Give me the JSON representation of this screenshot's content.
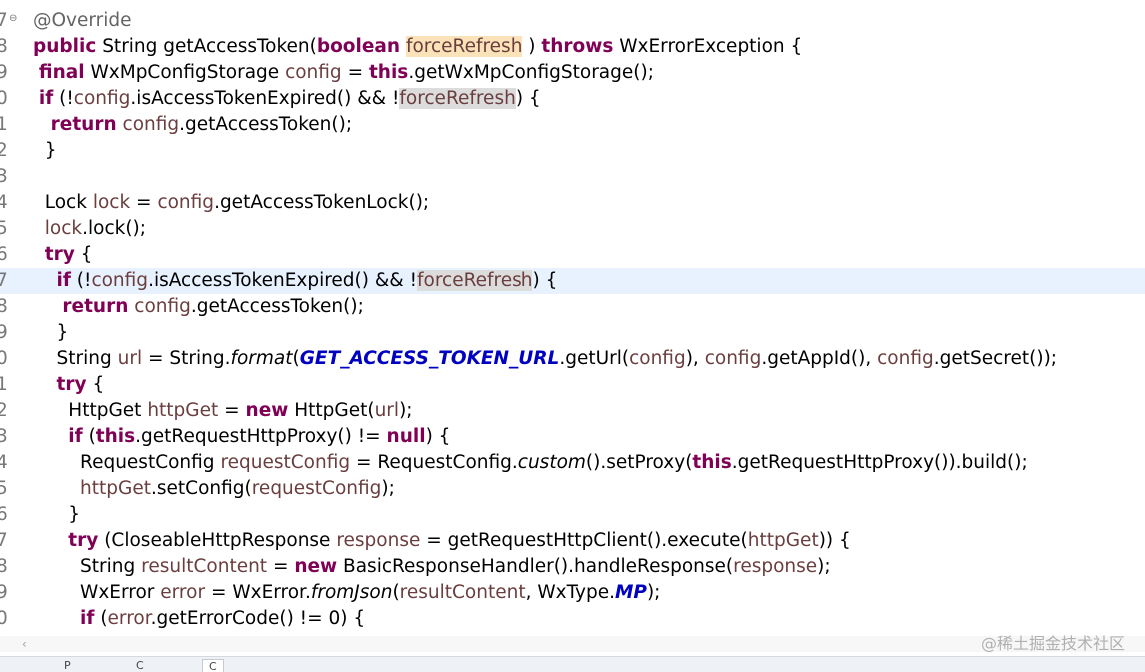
{
  "editor": {
    "current_line_number": "7",
    "lines": [
      {
        "n": "7",
        "fold": "⊖",
        "tokens": [
          [
            "ann",
            "@Override"
          ]
        ]
      },
      {
        "n": "8",
        "tokens": [
          [
            "kw",
            "public"
          ],
          [
            "",
            " String getAccessToken("
          ],
          [
            "kw",
            "boolean"
          ],
          [
            "",
            " "
          ],
          [
            "var hlw",
            "forceRefresh"
          ],
          [
            "",
            " ) "
          ],
          [
            "kw",
            "throws"
          ],
          [
            "",
            " WxErrorException {"
          ]
        ]
      },
      {
        "n": "9",
        "tokens": [
          [
            "",
            " "
          ],
          [
            "kw",
            "final"
          ],
          [
            "",
            " WxMpConfigStorage "
          ],
          [
            "var",
            "config"
          ],
          [
            "",
            " = "
          ],
          [
            "kw",
            "this"
          ],
          [
            "",
            ".getWxMpConfigStorage();"
          ]
        ]
      },
      {
        "n": "0",
        "tokens": [
          [
            "",
            " "
          ],
          [
            "kw",
            "if"
          ],
          [
            "",
            " (!"
          ],
          [
            "var",
            "config"
          ],
          [
            "",
            ".isAccessTokenExpired() && !"
          ],
          [
            "var hlr",
            "forceRefresh"
          ],
          [
            "",
            ") {"
          ]
        ]
      },
      {
        "n": "1",
        "tokens": [
          [
            "",
            "   "
          ],
          [
            "kw",
            "return"
          ],
          [
            "",
            " "
          ],
          [
            "var",
            "config"
          ],
          [
            "",
            ".getAccessToken();"
          ]
        ]
      },
      {
        "n": "2",
        "tokens": [
          [
            "",
            "  }"
          ]
        ]
      },
      {
        "n": "3",
        "tokens": []
      },
      {
        "n": "4",
        "tokens": [
          [
            "",
            "  Lock "
          ],
          [
            "var",
            "lock"
          ],
          [
            "",
            " = "
          ],
          [
            "var",
            "config"
          ],
          [
            "",
            ".getAccessTokenLock();"
          ]
        ]
      },
      {
        "n": "5",
        "tokens": [
          [
            "",
            "  "
          ],
          [
            "var",
            "lock"
          ],
          [
            "",
            ".lock();"
          ]
        ]
      },
      {
        "n": "6",
        "tokens": [
          [
            "",
            "  "
          ],
          [
            "kw",
            "try"
          ],
          [
            "",
            " {"
          ]
        ]
      },
      {
        "n": "7",
        "current": true,
        "tokens": [
          [
            "",
            "    "
          ],
          [
            "kw",
            "if"
          ],
          [
            "",
            " (!"
          ],
          [
            "var",
            "config"
          ],
          [
            "",
            ".isAccessTokenExpired() && !"
          ],
          [
            "var hlr",
            "forceRefres"
          ],
          [
            "caret",
            ""
          ],
          [
            "var hlr",
            "h"
          ],
          [
            "",
            ") {"
          ]
        ]
      },
      {
        "n": "8",
        "tokens": [
          [
            "",
            "     "
          ],
          [
            "kw",
            "return"
          ],
          [
            "",
            " "
          ],
          [
            "var",
            "config"
          ],
          [
            "",
            ".getAccessToken();"
          ]
        ]
      },
      {
        "n": "9",
        "tokens": [
          [
            "",
            "    }"
          ]
        ]
      },
      {
        "n": "0",
        "tokens": [
          [
            "",
            "    String "
          ],
          [
            "var",
            "url"
          ],
          [
            "",
            " = String."
          ],
          [
            "it",
            "format"
          ],
          [
            "",
            "("
          ],
          [
            "fld",
            "GET_ACCESS_TOKEN_URL"
          ],
          [
            "",
            ".getUrl("
          ],
          [
            "var",
            "config"
          ],
          [
            "",
            "), "
          ],
          [
            "var",
            "config"
          ],
          [
            "",
            ".getAppId(), "
          ],
          [
            "var",
            "config"
          ],
          [
            "",
            ".getSecret());"
          ]
        ]
      },
      {
        "n": "1",
        "tokens": [
          [
            "",
            "    "
          ],
          [
            "kw",
            "try"
          ],
          [
            "",
            " {"
          ]
        ]
      },
      {
        "n": "2",
        "tokens": [
          [
            "",
            "      HttpGet "
          ],
          [
            "var",
            "httpGet"
          ],
          [
            "",
            " = "
          ],
          [
            "kw",
            "new"
          ],
          [
            "",
            " HttpGet("
          ],
          [
            "var",
            "url"
          ],
          [
            "",
            ");"
          ]
        ]
      },
      {
        "n": "3",
        "tokens": [
          [
            "",
            "      "
          ],
          [
            "kw",
            "if"
          ],
          [
            "",
            " ("
          ],
          [
            "kw",
            "this"
          ],
          [
            "",
            ".getRequestHttpProxy() != "
          ],
          [
            "kw",
            "null"
          ],
          [
            "",
            ") {"
          ]
        ]
      },
      {
        "n": "4",
        "tokens": [
          [
            "",
            "        RequestConfig "
          ],
          [
            "var",
            "requestConfig"
          ],
          [
            "",
            " = RequestConfig."
          ],
          [
            "it",
            "custom"
          ],
          [
            "",
            "().setProxy("
          ],
          [
            "kw",
            "this"
          ],
          [
            "",
            ".getRequestHttpProxy()).build();"
          ]
        ]
      },
      {
        "n": "5",
        "tokens": [
          [
            "",
            "        "
          ],
          [
            "var",
            "httpGet"
          ],
          [
            "",
            ".setConfig("
          ],
          [
            "var",
            "requestConfig"
          ],
          [
            "",
            ");"
          ]
        ]
      },
      {
        "n": "6",
        "tokens": [
          [
            "",
            "      }"
          ]
        ]
      },
      {
        "n": "7",
        "tokens": [
          [
            "",
            "      "
          ],
          [
            "kw",
            "try"
          ],
          [
            "",
            " (CloseableHttpResponse "
          ],
          [
            "var",
            "response"
          ],
          [
            "",
            " = getRequestHttpClient().execute("
          ],
          [
            "var",
            "httpGet"
          ],
          [
            "",
            ")) {"
          ]
        ]
      },
      {
        "n": "8",
        "tokens": [
          [
            "",
            "        String "
          ],
          [
            "var",
            "resultContent"
          ],
          [
            "",
            " = "
          ],
          [
            "kw",
            "new"
          ],
          [
            "",
            " BasicResponseHandler().handleResponse("
          ],
          [
            "var",
            "response"
          ],
          [
            "",
            ");"
          ]
        ]
      },
      {
        "n": "9",
        "tokens": [
          [
            "",
            "        WxError "
          ],
          [
            "var",
            "error"
          ],
          [
            "",
            " = WxError."
          ],
          [
            "it",
            "fromJson"
          ],
          [
            "",
            "("
          ],
          [
            "var",
            "resultContent"
          ],
          [
            "",
            ", WxType."
          ],
          [
            "fld",
            "MP"
          ],
          [
            "",
            ");"
          ]
        ]
      },
      {
        "n": "0",
        "tokens": [
          [
            "",
            "        "
          ],
          [
            "kw",
            "if"
          ],
          [
            "",
            " ("
          ],
          [
            "var",
            "error"
          ],
          [
            "",
            ".getErrorCode() != 0) {"
          ]
        ]
      }
    ]
  },
  "scrollbar": {
    "left_arrow": "‹"
  },
  "watermark": "@稀土掘金技术社区",
  "bottom_tabs": [
    {
      "label": "P",
      "active": false
    },
    {
      "label": "C",
      "active": false
    },
    {
      "label": "C",
      "active": true
    }
  ]
}
